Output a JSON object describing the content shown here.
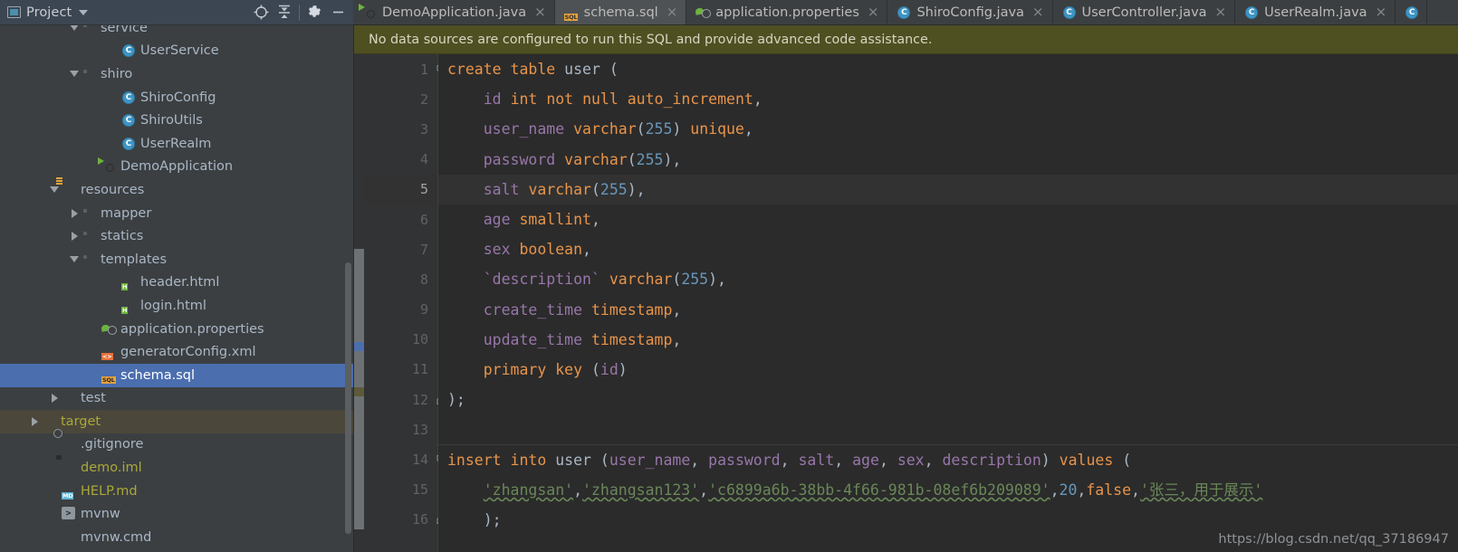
{
  "window": {
    "project_panel_title": "Project",
    "toolbar_icons": [
      "locate-crosshair-icon",
      "collapse-all-icon",
      "gear-icon",
      "minimize-icon"
    ]
  },
  "tabs": [
    {
      "label": "DemoApplication.java",
      "icon": "spring-boot-class-icon",
      "active": false,
      "close": "×"
    },
    {
      "label": "schema.sql",
      "icon": "sql-file-icon",
      "active": true,
      "close": "×"
    },
    {
      "label": "application.properties",
      "icon": "spring-properties-icon",
      "active": false,
      "close": "×"
    },
    {
      "label": "ShiroConfig.java",
      "icon": "java-class-icon",
      "active": false,
      "close": "×"
    },
    {
      "label": "UserController.java",
      "icon": "java-class-icon",
      "active": false,
      "close": "×"
    },
    {
      "label": "UserRealm.java",
      "icon": "java-class-icon",
      "active": false,
      "close": "×"
    }
  ],
  "notification": {
    "message": "No data sources are configured to run this SQL and provide advanced code assistance."
  },
  "project_tree": [
    {
      "label": "service",
      "indent": 3,
      "arrow": "down",
      "icon": "folder-icon",
      "color": "gray",
      "state": "normal"
    },
    {
      "label": "UserService",
      "indent": 5,
      "arrow": "none",
      "icon": "java-class-icon",
      "color": "gray",
      "state": "normal"
    },
    {
      "label": "shiro",
      "indent": 3,
      "arrow": "down",
      "icon": "folder-icon",
      "color": "gray",
      "state": "normal"
    },
    {
      "label": "ShiroConfig",
      "indent": 5,
      "arrow": "none",
      "icon": "java-class-icon",
      "color": "gray",
      "state": "normal"
    },
    {
      "label": "ShiroUtils",
      "indent": 5,
      "arrow": "none",
      "icon": "java-class-icon",
      "color": "gray",
      "state": "normal"
    },
    {
      "label": "UserRealm",
      "indent": 5,
      "arrow": "none",
      "icon": "java-class-icon",
      "color": "gray",
      "state": "normal"
    },
    {
      "label": "DemoApplication",
      "indent": 4,
      "arrow": "none",
      "icon": "spring-boot-class-icon",
      "color": "gray",
      "state": "normal"
    },
    {
      "label": "resources",
      "indent": 2,
      "arrow": "down",
      "icon": "resources-folder-icon",
      "color": "gray",
      "state": "normal"
    },
    {
      "label": "mapper",
      "indent": 3,
      "arrow": "right",
      "icon": "folder-icon",
      "color": "gray",
      "state": "normal"
    },
    {
      "label": "statics",
      "indent": 3,
      "arrow": "right",
      "icon": "folder-icon",
      "color": "gray",
      "state": "normal"
    },
    {
      "label": "templates",
      "indent": 3,
      "arrow": "down",
      "icon": "folder-icon",
      "color": "gray",
      "state": "normal"
    },
    {
      "label": "header.html",
      "indent": 5,
      "arrow": "none",
      "icon": "html-file-icon",
      "color": "gray",
      "state": "normal"
    },
    {
      "label": "login.html",
      "indent": 5,
      "arrow": "none",
      "icon": "html-file-icon",
      "color": "gray",
      "state": "normal"
    },
    {
      "label": "application.properties",
      "indent": 4,
      "arrow": "none",
      "icon": "spring-properties-icon",
      "color": "gray",
      "state": "normal"
    },
    {
      "label": "generatorConfig.xml",
      "indent": 4,
      "arrow": "none",
      "icon": "xml-file-icon",
      "color": "gray",
      "state": "normal"
    },
    {
      "label": "schema.sql",
      "indent": 4,
      "arrow": "none",
      "icon": "sql-file-icon",
      "color": "gray",
      "state": "selected"
    },
    {
      "label": "test",
      "indent": 2,
      "arrow": "right",
      "icon": "plain-folder-icon",
      "color": "gray",
      "state": "normal"
    },
    {
      "label": "target",
      "indent": 1,
      "arrow": "right",
      "icon": "orange-folder-icon",
      "color": "olive",
      "state": "highlighted"
    },
    {
      "label": ".gitignore",
      "indent": 2,
      "arrow": "none",
      "icon": "gitignore-file-icon",
      "color": "gray",
      "state": "normal"
    },
    {
      "label": "demo.iml",
      "indent": 2,
      "arrow": "none",
      "icon": "iml-file-icon",
      "color": "olive",
      "state": "normal"
    },
    {
      "label": "HELP.md",
      "indent": 2,
      "arrow": "none",
      "icon": "markdown-file-icon",
      "color": "olive",
      "state": "normal"
    },
    {
      "label": "mvnw",
      "indent": 2,
      "arrow": "none",
      "icon": "shell-script-icon",
      "color": "gray",
      "state": "normal"
    },
    {
      "label": "mvnw.cmd",
      "indent": 2,
      "arrow": "none",
      "icon": "cmd-file-icon",
      "color": "gray",
      "state": "normal"
    }
  ],
  "editor": {
    "file": "schema.sql",
    "language": "SQL",
    "current_line": 5,
    "line_numbers": [
      1,
      2,
      3,
      4,
      5,
      6,
      7,
      8,
      9,
      10,
      11,
      12,
      13,
      14,
      15,
      16
    ],
    "lines": [
      {
        "no": 1,
        "text": "create table user ("
      },
      {
        "no": 2,
        "text": "    id int not null auto_increment,"
      },
      {
        "no": 3,
        "text": "    user_name varchar(255) unique,"
      },
      {
        "no": 4,
        "text": "    password varchar(255),"
      },
      {
        "no": 5,
        "text": "    salt varchar(255),"
      },
      {
        "no": 6,
        "text": "    age smallint,"
      },
      {
        "no": 7,
        "text": "    sex boolean,"
      },
      {
        "no": 8,
        "text": "    `description` varchar(255),"
      },
      {
        "no": 9,
        "text": "    create_time timestamp,"
      },
      {
        "no": 10,
        "text": "    update_time timestamp,"
      },
      {
        "no": 11,
        "text": "    primary key (id)"
      },
      {
        "no": 12,
        "text": ");"
      },
      {
        "no": 13,
        "text": ""
      },
      {
        "no": 14,
        "text": "insert into user (user_name, password, salt, age, sex, description) values ("
      },
      {
        "no": 15,
        "text": "    'zhangsan','zhangsan123','c6899a6b-38bb-4f66-981b-08ef6b209089',20,false,'张三，用于展示'"
      },
      {
        "no": 16,
        "text": "    );"
      }
    ],
    "tokens": {
      "l1": [
        [
          "k",
          "create"
        ],
        [
          "p",
          " "
        ],
        [
          "k",
          "table"
        ],
        [
          "p",
          " "
        ],
        [
          "tbl",
          "user"
        ],
        [
          "p",
          " ("
        ]
      ],
      "l2": [
        [
          "p",
          "    "
        ],
        [
          "id",
          "id"
        ],
        [
          "p",
          " "
        ],
        [
          "k",
          "int"
        ],
        [
          "p",
          " "
        ],
        [
          "k",
          "not"
        ],
        [
          "p",
          " "
        ],
        [
          "k",
          "null"
        ],
        [
          "p",
          " "
        ],
        [
          "k",
          "auto_increment"
        ],
        [
          "p",
          ","
        ]
      ],
      "l3": [
        [
          "p",
          "    "
        ],
        [
          "id",
          "user_name"
        ],
        [
          "p",
          " "
        ],
        [
          "k",
          "varchar"
        ],
        [
          "p",
          "("
        ],
        [
          "n",
          "255"
        ],
        [
          "p",
          ") "
        ],
        [
          "k",
          "unique"
        ],
        [
          "p",
          ","
        ]
      ],
      "l4": [
        [
          "p",
          "    "
        ],
        [
          "id",
          "password"
        ],
        [
          "p",
          " "
        ],
        [
          "k",
          "varchar"
        ],
        [
          "p",
          "("
        ],
        [
          "n",
          "255"
        ],
        [
          "p",
          "),"
        ]
      ],
      "l5": [
        [
          "p",
          "    "
        ],
        [
          "id",
          "salt"
        ],
        [
          "p",
          " "
        ],
        [
          "k",
          "varchar"
        ],
        [
          "p",
          "("
        ],
        [
          "n",
          "255"
        ],
        [
          "p",
          "),"
        ]
      ],
      "l6": [
        [
          "p",
          "    "
        ],
        [
          "id",
          "age"
        ],
        [
          "p",
          " "
        ],
        [
          "k",
          "smallint"
        ],
        [
          "p",
          ","
        ]
      ],
      "l7": [
        [
          "p",
          "    "
        ],
        [
          "id",
          "sex"
        ],
        [
          "p",
          " "
        ],
        [
          "k",
          "boolean"
        ],
        [
          "p",
          ","
        ]
      ],
      "l8": [
        [
          "p",
          "    "
        ],
        [
          "id",
          "`description`"
        ],
        [
          "p",
          " "
        ],
        [
          "k",
          "varchar"
        ],
        [
          "p",
          "("
        ],
        [
          "n",
          "255"
        ],
        [
          "p",
          "),"
        ]
      ],
      "l9": [
        [
          "p",
          "    "
        ],
        [
          "id",
          "create_time"
        ],
        [
          "p",
          " "
        ],
        [
          "k",
          "timestamp"
        ],
        [
          "p",
          ","
        ]
      ],
      "l10": [
        [
          "p",
          "    "
        ],
        [
          "id",
          "update_time"
        ],
        [
          "p",
          " "
        ],
        [
          "k",
          "timestamp"
        ],
        [
          "p",
          ","
        ]
      ],
      "l11": [
        [
          "p",
          "    "
        ],
        [
          "k",
          "primary"
        ],
        [
          "p",
          " "
        ],
        [
          "k",
          "key"
        ],
        [
          "p",
          " ("
        ],
        [
          "id",
          "id"
        ],
        [
          "p",
          ")"
        ]
      ],
      "l12": [
        [
          "p",
          ");"
        ]
      ],
      "l13": [],
      "l14": [
        [
          "k",
          "insert"
        ],
        [
          "p",
          " "
        ],
        [
          "k",
          "into"
        ],
        [
          "p",
          " "
        ],
        [
          "tbl",
          "user"
        ],
        [
          "p",
          " ("
        ],
        [
          "id",
          "user_name"
        ],
        [
          "p",
          ", "
        ],
        [
          "id",
          "password"
        ],
        [
          "p",
          ", "
        ],
        [
          "id",
          "salt"
        ],
        [
          "p",
          ", "
        ],
        [
          "id",
          "age"
        ],
        [
          "p",
          ", "
        ],
        [
          "id",
          "sex"
        ],
        [
          "p",
          ", "
        ],
        [
          "id",
          "description"
        ],
        [
          "p",
          ") "
        ],
        [
          "k",
          "values"
        ],
        [
          "p",
          " ("
        ]
      ],
      "l15": [
        [
          "p",
          "    "
        ],
        [
          "s",
          "'zhangsan'"
        ],
        [
          "p",
          ","
        ],
        [
          "s",
          "'zhangsan123'"
        ],
        [
          "p",
          ","
        ],
        [
          "s",
          "'c6899a6b-38bb-4f66-981b-08ef6b209089'"
        ],
        [
          "p",
          ","
        ],
        [
          "n",
          "20"
        ],
        [
          "p",
          ","
        ],
        [
          "k",
          "false"
        ],
        [
          "p",
          ","
        ],
        [
          "s",
          "'张三，用于展示'"
        ]
      ],
      "l16": [
        [
          "p",
          "    );"
        ]
      ]
    },
    "fold_lines": [
      1,
      12,
      14,
      16
    ]
  },
  "watermark": {
    "text": "https://blog.csdn.net/qq_37186947"
  },
  "colors": {
    "keyword": "#e8944a",
    "identifier": "#9876aa",
    "number": "#6897bb",
    "string": "#6a8759",
    "plain": "#a9b7c6",
    "editor_bg": "#2b2b2b",
    "gutter_bg": "#313335",
    "panel_bg": "#3c3f41",
    "selection_blue": "#4b6eaf",
    "notification_bg": "#4e5022",
    "toolbar_bg": "#3c4552",
    "active_tab_bg": "#4e5254"
  }
}
